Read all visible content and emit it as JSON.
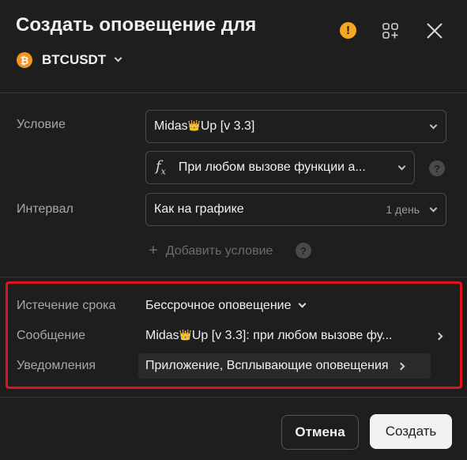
{
  "header": {
    "title": "Создать оповещение для",
    "symbol": "BTCUSDT",
    "coin_glyph": "₿",
    "warning_glyph": "!",
    "icons": [
      "bitcoin-icon",
      "warning-icon",
      "add-widget-icon",
      "close-icon"
    ]
  },
  "condition": {
    "label": "Условие",
    "indicator_prefix": "Midas",
    "indicator_suffix": "Up [v 3.3]",
    "trigger": "При любом вызове функции а...",
    "help_glyph": "?"
  },
  "interval": {
    "label": "Интервал",
    "value": "Как на графике",
    "sub_value": "1 день"
  },
  "add_condition": {
    "plus": "+",
    "label": "Добавить условие",
    "help_glyph": "?"
  },
  "expiration": {
    "label": "Истечение срока",
    "value": "Бессрочное оповещение"
  },
  "message": {
    "label": "Сообщение",
    "prefix": "Midas",
    "suffix": "Up [v 3.3]: при любом вызове фу..."
  },
  "notifications": {
    "label": "Уведомления",
    "value": "Приложение, Всплывающие оповещения"
  },
  "footer": {
    "cancel_label": "Отмена",
    "create_label": "Создать"
  },
  "colors": {
    "background": "#1e1e1e",
    "coin": "#f7931a",
    "warning": "#f5a623",
    "highlight": "#e0141e",
    "primary_button": "#f2f2f2"
  }
}
